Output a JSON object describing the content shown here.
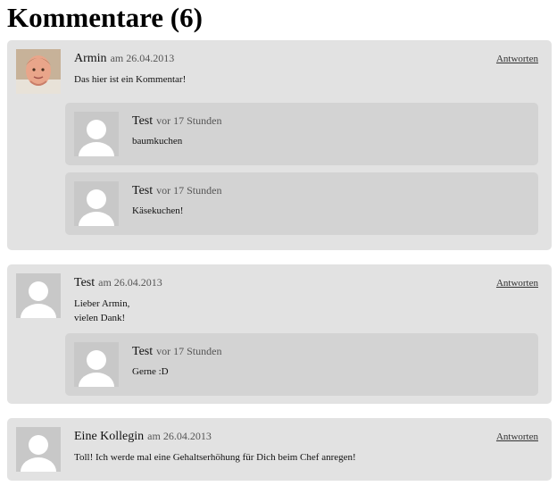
{
  "title": "Kommentare (6)",
  "reply_label": "Antworten",
  "comments": [
    {
      "author": "Armin",
      "date": "am 26.04.2013",
      "text": "Das hier ist ein Kommentar!",
      "avatar": "photo-avatar-icon",
      "replies": [
        {
          "author": "Test",
          "date": "vor 17 Stunden",
          "text": "baumkuchen",
          "avatar": "default-avatar-icon"
        },
        {
          "author": "Test",
          "date": "vor 17 Stunden",
          "text": "Käsekuchen!",
          "avatar": "default-avatar-icon"
        }
      ]
    },
    {
      "author": "Test",
      "date": "am 26.04.2013",
      "text": "Lieber Armin,\nvielen Dank!",
      "avatar": "default-avatar-icon",
      "replies": [
        {
          "author": "Test",
          "date": "vor 17 Stunden",
          "text": "Gerne :D",
          "avatar": "default-avatar-icon"
        }
      ]
    },
    {
      "author": "Eine Kollegin",
      "date": "am 26.04.2013",
      "text": "Toll! Ich werde mal eine Gehaltserhöhung für Dich beim Chef anregen!",
      "avatar": "default-avatar-icon",
      "replies": []
    }
  ],
  "colors": {
    "comment_bg": "#e2e2e2",
    "reply_bg": "#d3d3d3",
    "avatar_bg": "#c8c8c8"
  }
}
